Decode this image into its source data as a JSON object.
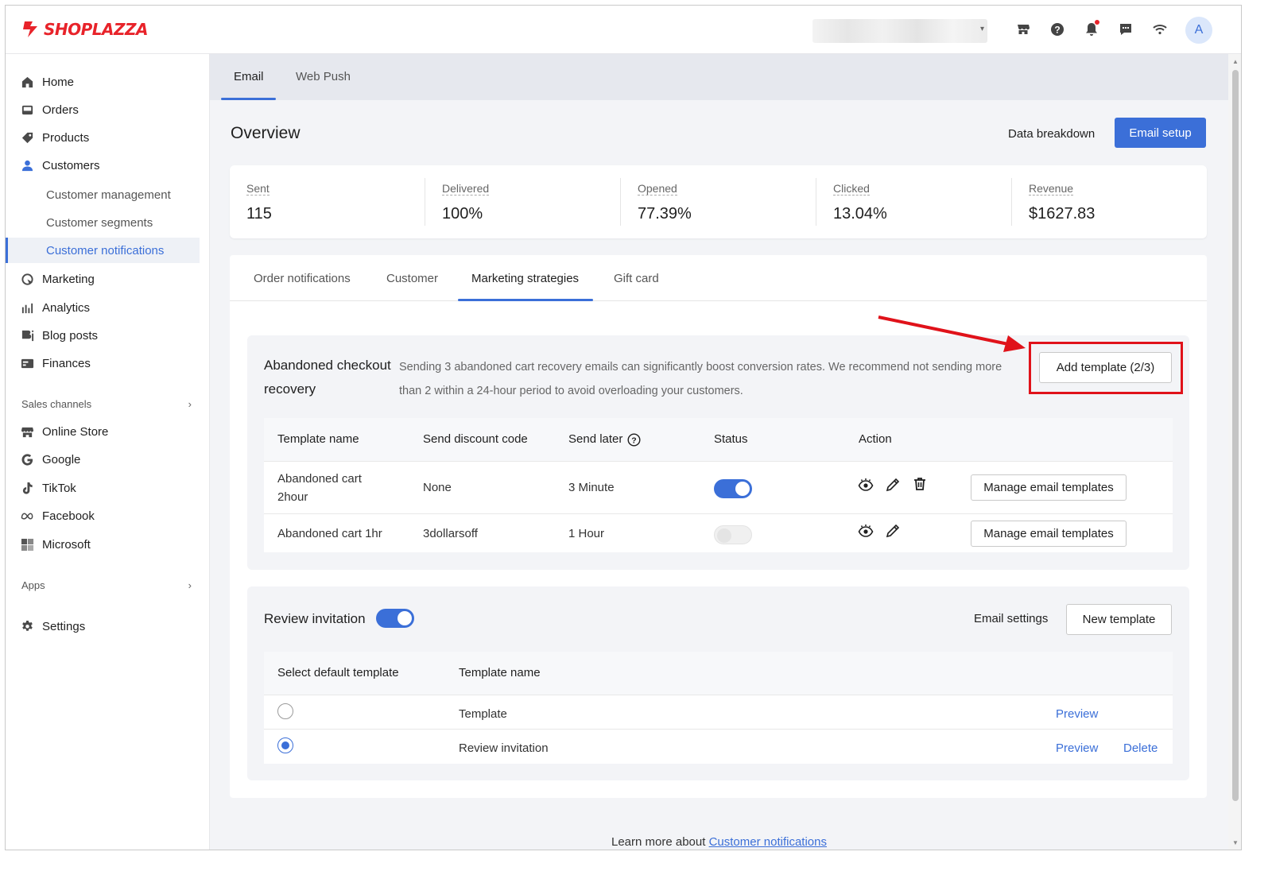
{
  "brand": {
    "name": "SHOPLAZZA",
    "color": "#e8232a"
  },
  "header": {
    "avatar_initial": "A",
    "icons": [
      "store-icon",
      "help-icon",
      "bell-icon",
      "chat-icon",
      "wifi-icon"
    ]
  },
  "sidebar": {
    "items": [
      {
        "label": "Home",
        "icon": "home-icon"
      },
      {
        "label": "Orders",
        "icon": "orders-icon"
      },
      {
        "label": "Products",
        "icon": "tag-icon"
      },
      {
        "label": "Customers",
        "icon": "person-icon"
      },
      {
        "label": "Customer management"
      },
      {
        "label": "Customer segments"
      },
      {
        "label": "Customer notifications"
      },
      {
        "label": "Marketing",
        "icon": "marketing-icon"
      },
      {
        "label": "Analytics",
        "icon": "analytics-icon"
      },
      {
        "label": "Blog posts",
        "icon": "blog-icon"
      },
      {
        "label": "Finances",
        "icon": "finances-icon"
      }
    ],
    "sales_channels_label": "Sales channels",
    "channels": [
      {
        "label": "Online Store",
        "icon": "store-icon"
      },
      {
        "label": "Google",
        "icon": "google-icon"
      },
      {
        "label": "TikTok",
        "icon": "tiktok-icon"
      },
      {
        "label": "Facebook",
        "icon": "meta-icon"
      },
      {
        "label": "Microsoft",
        "icon": "microsoft-icon"
      }
    ],
    "apps_label": "Apps",
    "settings_label": "Settings"
  },
  "top_tabs": [
    {
      "label": "Email"
    },
    {
      "label": "Web Push"
    }
  ],
  "overview": {
    "title": "Overview",
    "data_breakdown": "Data breakdown",
    "email_setup": "Email setup"
  },
  "stats": [
    {
      "label": "Sent",
      "value": "115"
    },
    {
      "label": "Delivered",
      "value": "100%"
    },
    {
      "label": "Opened",
      "value": "77.39%"
    },
    {
      "label": "Clicked",
      "value": "13.04%"
    },
    {
      "label": "Revenue",
      "value": "$1627.83"
    }
  ],
  "sub_tabs": [
    {
      "label": "Order notifications"
    },
    {
      "label": "Customer"
    },
    {
      "label": "Marketing strategies"
    },
    {
      "label": "Gift card"
    }
  ],
  "abandoned": {
    "title": "Abandoned checkout recovery",
    "description": "Sending 3 abandoned cart recovery emails can significantly boost conversion rates. We recommend not sending more than 2 within a 24-hour period to avoid overloading your customers.",
    "add_template": "Add template (2/3)",
    "columns": [
      "Template name",
      "Send discount code",
      "Send later",
      "Status",
      "Action"
    ],
    "rows": [
      {
        "name": "Abandoned cart 2hour",
        "discount": "None",
        "send_later": "3 Minute",
        "status_on": true,
        "manage": "Manage email templates"
      },
      {
        "name": "Abandoned cart 1hr",
        "discount": "3dollarsoff",
        "send_later": "1 Hour",
        "status_on": false,
        "manage": "Manage email templates"
      }
    ]
  },
  "review": {
    "title": "Review invitation",
    "enabled": true,
    "email_settings": "Email settings",
    "new_template": "New template",
    "columns": [
      "Select default template",
      "Template name"
    ],
    "rows": [
      {
        "name": "Template",
        "selected": false,
        "preview": "Preview",
        "delete": ""
      },
      {
        "name": "Review invitation",
        "selected": true,
        "preview": "Preview",
        "delete": "Delete"
      }
    ]
  },
  "footer": {
    "prefix": "Learn more about",
    "link": "Customer notifications"
  },
  "colors": {
    "accent": "#3b6fd8",
    "highlight": "#e0121a"
  }
}
